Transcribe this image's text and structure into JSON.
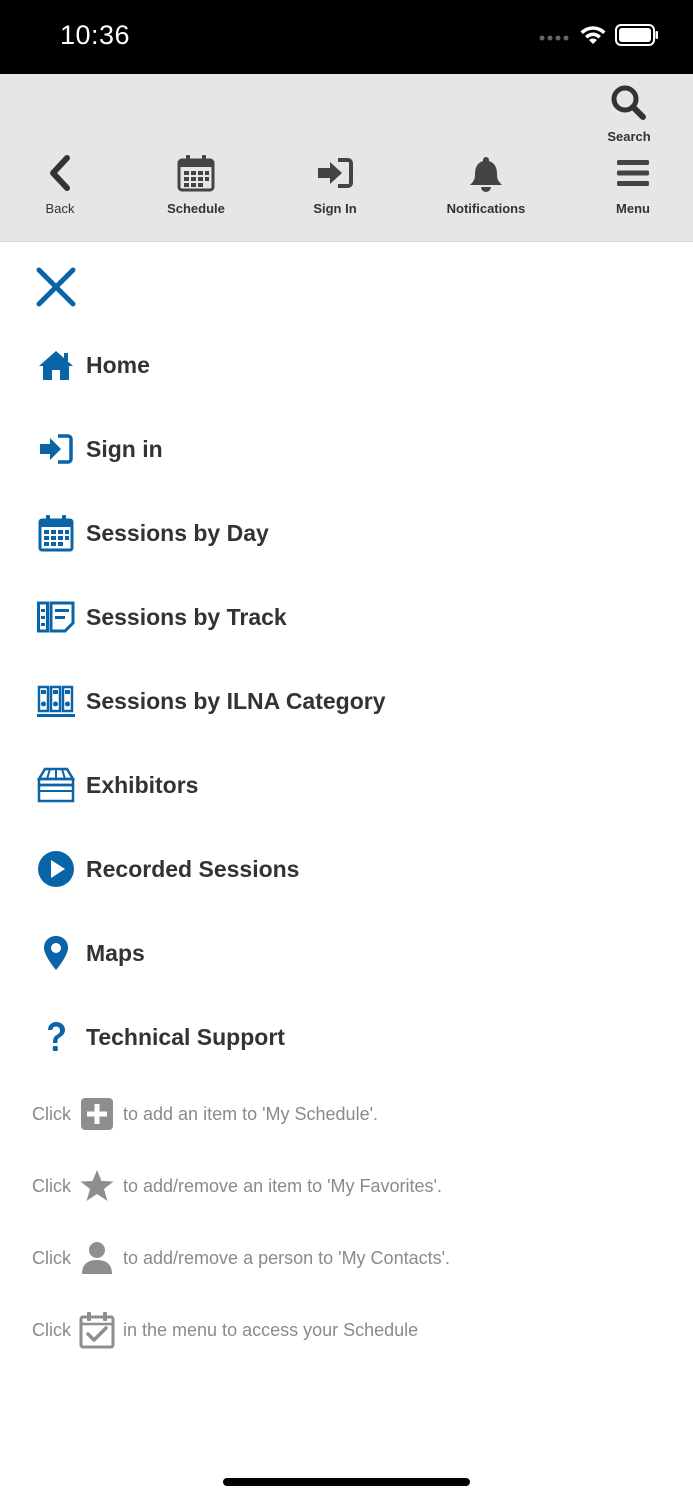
{
  "status": {
    "time": "10:36"
  },
  "toolbar": {
    "search": "Search",
    "back": "Back",
    "schedule": "Schedule",
    "sign_in": "Sign In",
    "notifications": "Notifications",
    "menu": "Menu"
  },
  "menu": {
    "items": [
      {
        "label": "Home",
        "icon": "home-icon"
      },
      {
        "label": "Sign in",
        "icon": "sign-in-icon"
      },
      {
        "label": "Sessions by Day",
        "icon": "calendar-icon"
      },
      {
        "label": "Sessions by Track",
        "icon": "track-list-icon"
      },
      {
        "label": "Sessions by ILNA Category",
        "icon": "binders-icon"
      },
      {
        "label": "Exhibitors",
        "icon": "booth-icon"
      },
      {
        "label": "Recorded Sessions",
        "icon": "play-icon"
      },
      {
        "label": "Maps",
        "icon": "map-pin-icon"
      },
      {
        "label": "Technical Support",
        "icon": "question-icon"
      }
    ]
  },
  "help": {
    "click": "Click",
    "add_schedule": "to add an item to 'My Schedule'.",
    "add_favorites": "to add/remove an item to 'My Favorites'.",
    "add_contacts": "to add/remove a person to 'My Contacts'.",
    "access_schedule": "in the menu to access your Schedule"
  },
  "colors": {
    "accent": "#0a64a8",
    "toolbar_bg": "#e6e6e6",
    "text": "#333333",
    "muted": "#8a8a8a"
  }
}
